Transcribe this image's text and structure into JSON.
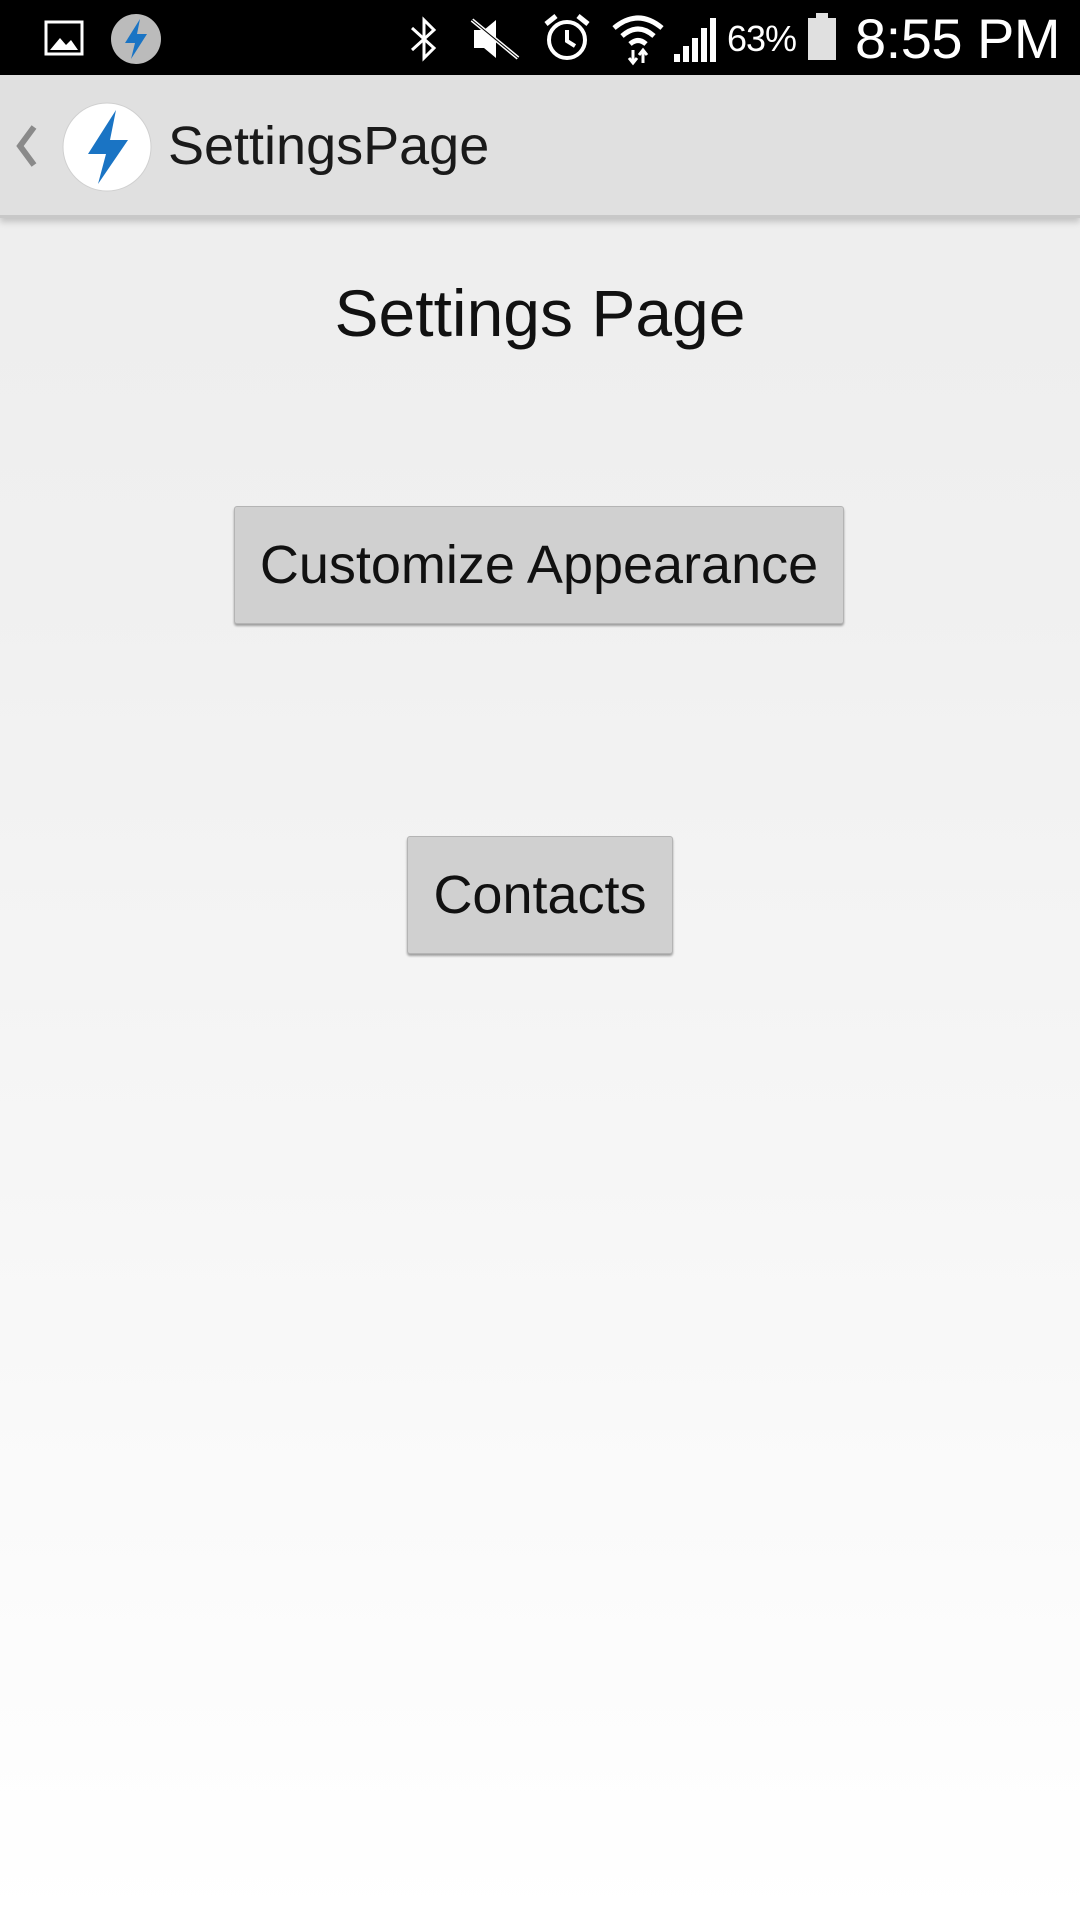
{
  "status_bar": {
    "icons_left": [
      "gallery-icon",
      "app-notification-icon"
    ],
    "icons_right": [
      "bluetooth-icon",
      "mute-icon",
      "alarm-icon",
      "wifi-icon",
      "signal-icon",
      "battery-icon"
    ],
    "battery_percent": "63%",
    "time": "8:55 PM"
  },
  "action_bar": {
    "title": "SettingsPage",
    "icon": "lightning-bolt-icon"
  },
  "content": {
    "heading": "Settings Page",
    "customize_button": "Customize Appearance",
    "contacts_button": "Contacts"
  },
  "colors": {
    "status_bar_bg": "#000000",
    "action_bar_bg": "#e0e0e0",
    "button_bg": "#d0d0d0",
    "brand_blue": "#1a74c4"
  }
}
